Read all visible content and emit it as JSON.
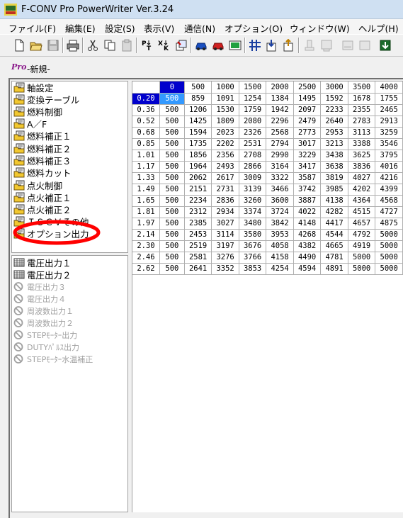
{
  "window": {
    "title": "F-CONV Pro PowerWriter Ver.3.24",
    "app_icon": "fconv-logo-icon"
  },
  "menu": [
    {
      "label": "ファイル(F)",
      "left": 0
    },
    {
      "label": "編集(E)"
    },
    {
      "label": "設定(S)"
    },
    {
      "label": "表示(V)"
    },
    {
      "label": "通信(N)"
    },
    {
      "label": "オプション(O)"
    },
    {
      "label": "ウィンドウ(W)"
    },
    {
      "label": "ヘルプ(H)"
    }
  ],
  "document": {
    "icon_text": "Pro",
    "title": "-新規-"
  },
  "tree_top": [
    {
      "label": "軸設定",
      "icon": "folder-doc-icon"
    },
    {
      "label": "変換テーブル",
      "icon": "folder-doc-icon"
    },
    {
      "label": "燃料制御",
      "icon": "folder-doc-icon"
    },
    {
      "label": "A／F",
      "icon": "folder-doc-icon"
    },
    {
      "label": "燃料補正１",
      "icon": "folder-doc-icon"
    },
    {
      "label": "燃料補正２",
      "icon": "folder-doc-icon"
    },
    {
      "label": "燃料補正３",
      "icon": "folder-doc-icon"
    },
    {
      "label": "燃料カット",
      "icon": "folder-doc-icon"
    },
    {
      "label": "点火制御",
      "icon": "folder-doc-icon"
    },
    {
      "label": "点火補正１",
      "icon": "folder-doc-icon"
    },
    {
      "label": "点火補正２",
      "icon": "folder-doc-icon"
    },
    {
      "label": "ＩＳＣＶその他",
      "icon": "folder-doc-icon"
    },
    {
      "label": "オプション出力",
      "icon": "folder-doc-icon"
    }
  ],
  "tree_bottom": [
    {
      "label": "電圧出力１",
      "enabled": true
    },
    {
      "label": "電圧出力２",
      "enabled": true
    },
    {
      "label": "電圧出力３",
      "enabled": false
    },
    {
      "label": "電圧出力４",
      "enabled": false
    },
    {
      "label": "周波数出力１",
      "enabled": false
    },
    {
      "label": "周波数出力２",
      "enabled": false
    },
    {
      "label": "STEPﾓｰﾀｰ出力",
      "enabled": false
    },
    {
      "label": "DUTYﾊﾟﾙｽ出力",
      "enabled": false
    },
    {
      "label": "STEPﾓｰﾀｰ水温補正",
      "enabled": false
    }
  ],
  "map": {
    "columns": [
      "0",
      "500",
      "1000",
      "1500",
      "2000",
      "2500",
      "3000",
      "3500",
      "4000"
    ],
    "rows": [
      {
        "key": "0.20",
        "values": [
          "500",
          "859",
          "1091",
          "1254",
          "1384",
          "1495",
          "1592",
          "1678",
          "1755"
        ]
      },
      {
        "key": "0.36",
        "values": [
          "500",
          "1206",
          "1530",
          "1759",
          "1942",
          "2097",
          "2233",
          "2355",
          "2465"
        ]
      },
      {
        "key": "0.52",
        "values": [
          "500",
          "1425",
          "1809",
          "2080",
          "2296",
          "2479",
          "2640",
          "2783",
          "2913"
        ]
      },
      {
        "key": "0.68",
        "values": [
          "500",
          "1594",
          "2023",
          "2326",
          "2568",
          "2773",
          "2953",
          "3113",
          "3259"
        ]
      },
      {
        "key": "0.85",
        "values": [
          "500",
          "1735",
          "2202",
          "2531",
          "2794",
          "3017",
          "3213",
          "3388",
          "3546"
        ]
      },
      {
        "key": "1.01",
        "values": [
          "500",
          "1856",
          "2356",
          "2708",
          "2990",
          "3229",
          "3438",
          "3625",
          "3795"
        ]
      },
      {
        "key": "1.17",
        "values": [
          "500",
          "1964",
          "2493",
          "2866",
          "3164",
          "3417",
          "3638",
          "3836",
          "4016"
        ]
      },
      {
        "key": "1.33",
        "values": [
          "500",
          "2062",
          "2617",
          "3009",
          "3322",
          "3587",
          "3819",
          "4027",
          "4216"
        ]
      },
      {
        "key": "1.49",
        "values": [
          "500",
          "2151",
          "2731",
          "3139",
          "3466",
          "3742",
          "3985",
          "4202",
          "4399"
        ]
      },
      {
        "key": "1.65",
        "values": [
          "500",
          "2234",
          "2836",
          "3260",
          "3600",
          "3887",
          "4138",
          "4364",
          "4568"
        ]
      },
      {
        "key": "1.81",
        "values": [
          "500",
          "2312",
          "2934",
          "3374",
          "3724",
          "4022",
          "4282",
          "4515",
          "4727"
        ]
      },
      {
        "key": "1.97",
        "values": [
          "500",
          "2385",
          "3027",
          "3480",
          "3842",
          "4148",
          "4417",
          "4657",
          "4875"
        ]
      },
      {
        "key": "2.14",
        "values": [
          "500",
          "2453",
          "3114",
          "3580",
          "3953",
          "4268",
          "4544",
          "4792",
          "5000"
        ]
      },
      {
        "key": "2.30",
        "values": [
          "500",
          "2519",
          "3197",
          "3676",
          "4058",
          "4382",
          "4665",
          "4919",
          "5000"
        ]
      },
      {
        "key": "2.46",
        "values": [
          "500",
          "2581",
          "3276",
          "3766",
          "4158",
          "4490",
          "4781",
          "5000",
          "5000"
        ]
      },
      {
        "key": "2.62",
        "values": [
          "500",
          "2641",
          "3352",
          "3853",
          "4254",
          "4594",
          "4891",
          "5000",
          "5000"
        ]
      }
    ],
    "selected_row": 0,
    "selected_col": 0
  },
  "toolbar": [
    "new-file-icon",
    "open-folder-icon",
    "save-icon",
    "print-icon",
    "cut-icon",
    "copy-icon",
    "paste-icon",
    "pt-icon",
    "xk-icon",
    "transfer-icon",
    "car-blue-icon",
    "car-red-icon",
    "monitor-icon",
    "grid-icon",
    "flash-write-icon",
    "flash-read-icon",
    "disabled-a-icon",
    "disabled-b-icon",
    "disabled-c-icon",
    "disabled-d-icon",
    "download-icon"
  ],
  "colors": {
    "select_header": "#0000cc",
    "select_cell": "#3399ff",
    "annotation_circle": "#ff0000"
  }
}
